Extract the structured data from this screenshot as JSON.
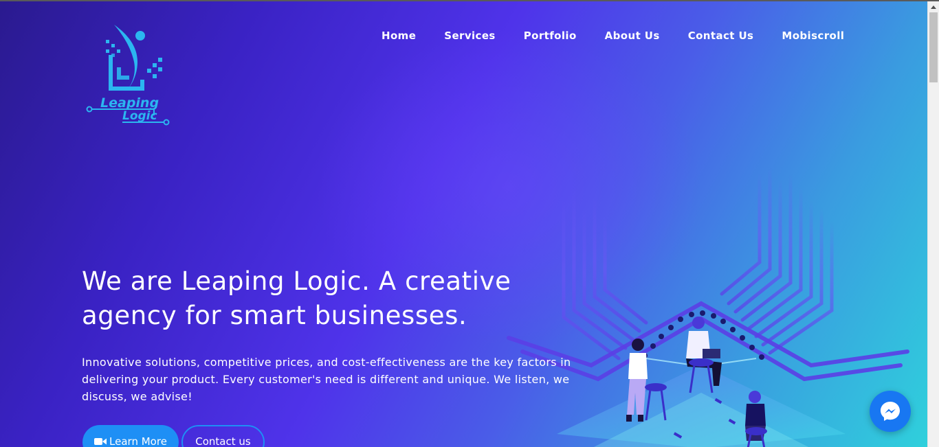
{
  "brand": {
    "logo_text_line1": "Leaping",
    "logo_text_line2": "Logic",
    "logo_color": "#2bb6f0"
  },
  "nav": {
    "items": [
      {
        "label": "Home"
      },
      {
        "label": "Services"
      },
      {
        "label": "Portfolio"
      },
      {
        "label": "About Us"
      },
      {
        "label": "Contact Us"
      },
      {
        "label": "Mobiscroll"
      }
    ]
  },
  "hero": {
    "headline": "We are Leaping Logic. A creative agency for smart businesses.",
    "subtext": "Innovative solutions, competitive prices, and cost-effectiveness are the key factors in delivering your product. Every customer's need is different and unique. We listen, we discuss, we advise!",
    "primary_button": {
      "label": "Learn More",
      "icon": "video-camera-icon"
    },
    "secondary_button": {
      "label": "Contact us"
    }
  },
  "chat_widget": {
    "icon": "messenger-icon",
    "color": "#1877f2"
  },
  "colors": {
    "accent": "#1e8ff5",
    "gradient_start": "#2a1a8f",
    "gradient_mid": "#4f33ea",
    "gradient_end": "#2fd0dc"
  }
}
